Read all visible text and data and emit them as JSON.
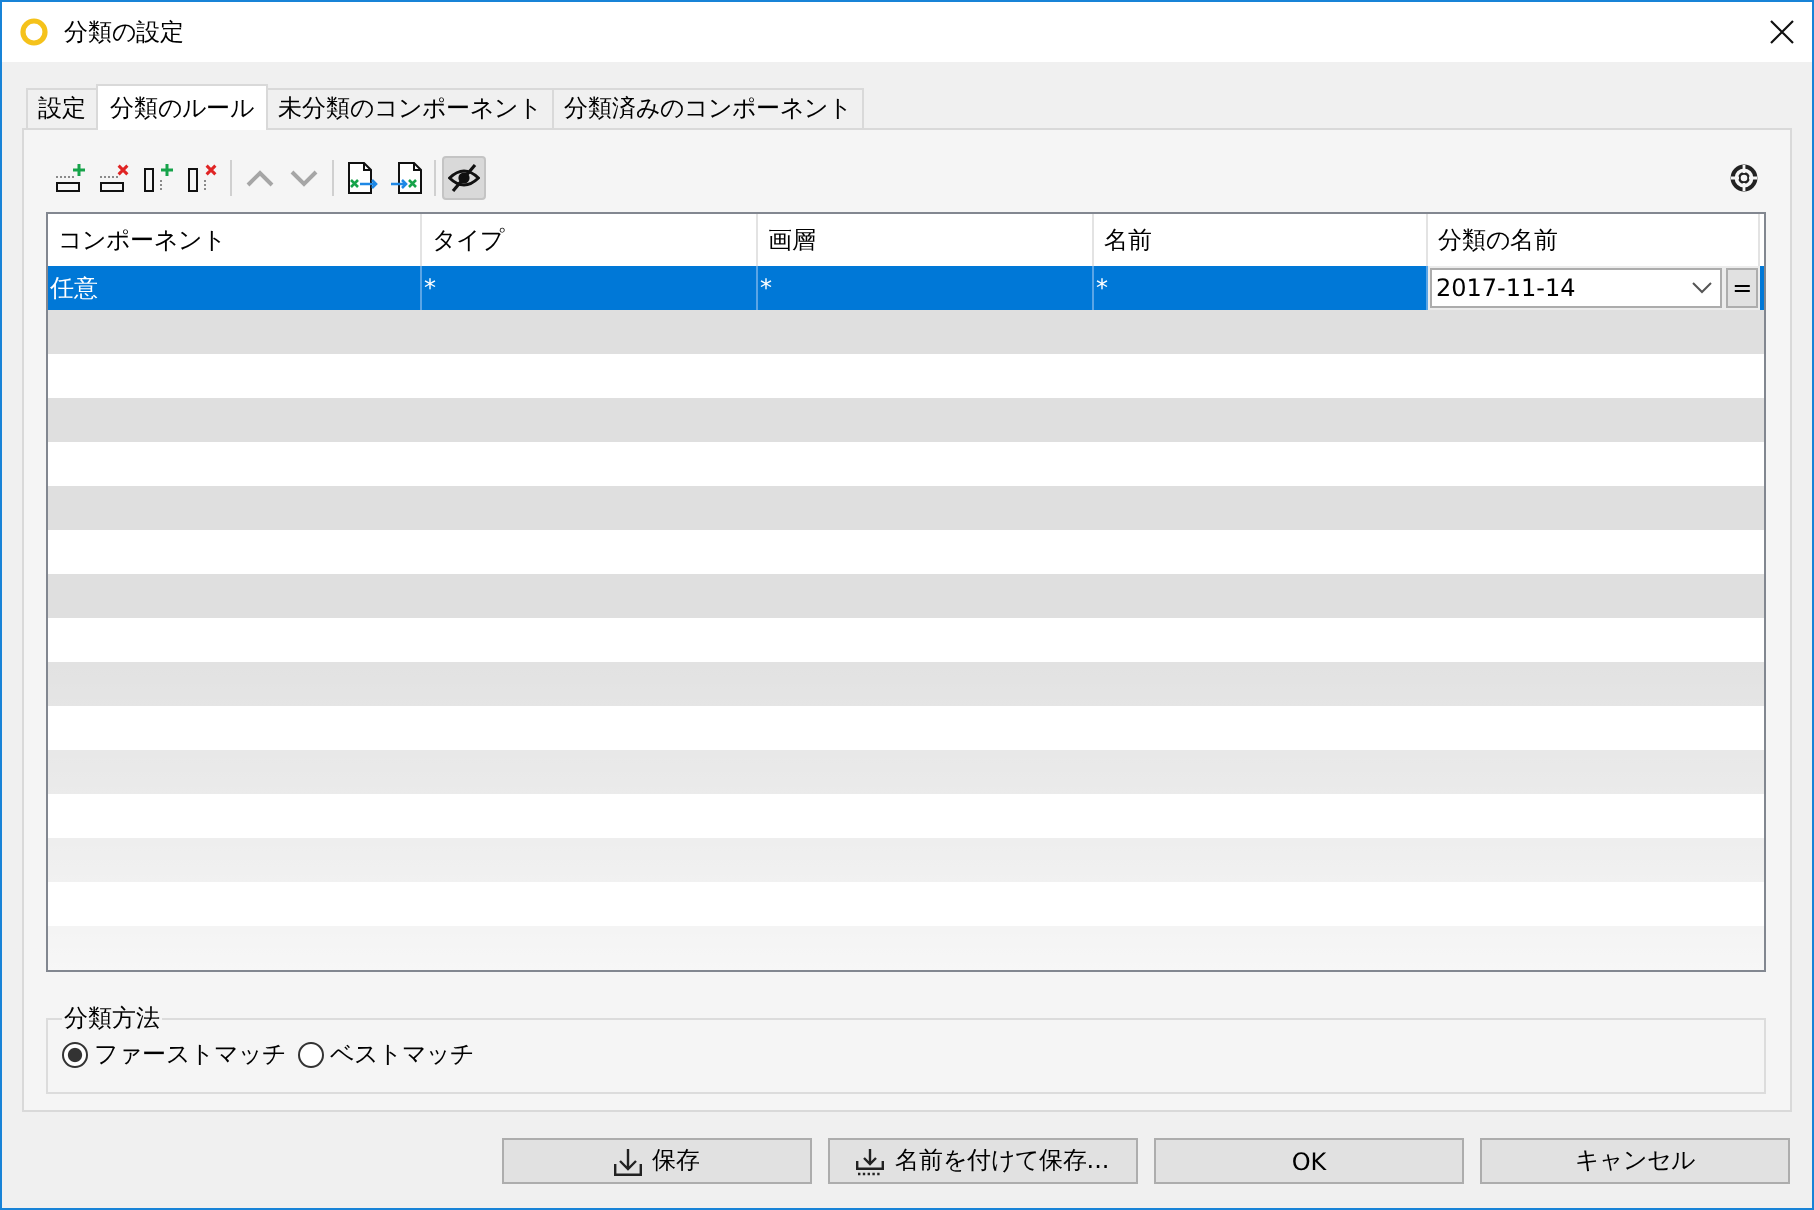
{
  "window": {
    "title": "分類の設定"
  },
  "tabs": [
    {
      "label": "設定",
      "selected": false
    },
    {
      "label": "分類のルール",
      "selected": true
    },
    {
      "label": "未分類のコンポーネント",
      "selected": false
    },
    {
      "label": "分類済みのコンポーネント",
      "selected": false
    }
  ],
  "toolbar": {
    "groups": [
      [
        {
          "kind": "add_row",
          "disabled": false,
          "pressed": false
        },
        {
          "kind": "remove_row",
          "disabled": false,
          "pressed": false
        },
        {
          "kind": "add_column",
          "disabled": false,
          "pressed": false
        },
        {
          "kind": "remove_column",
          "disabled": false,
          "pressed": false
        }
      ],
      [
        {
          "kind": "move_up",
          "disabled": true,
          "pressed": false
        },
        {
          "kind": "move_down",
          "disabled": true,
          "pressed": false
        }
      ],
      [
        {
          "kind": "export",
          "disabled": false,
          "pressed": false
        },
        {
          "kind": "import",
          "disabled": false,
          "pressed": false
        }
      ],
      [
        {
          "kind": "hide",
          "disabled": false,
          "pressed": true
        }
      ]
    ]
  },
  "table": {
    "columns": [
      "コンポーネント",
      "タイプ",
      "画層",
      "名前",
      "分類の名前"
    ],
    "rows": [
      {
        "selected": true,
        "cells": [
          "任意",
          "*",
          "*",
          "*"
        ],
        "category": {
          "value": "2017-11-14",
          "button": "="
        }
      }
    ]
  },
  "classification_method": {
    "title": "分類方法",
    "options": [
      {
        "label": "ファーストマッチ",
        "selected": true
      },
      {
        "label": "ベストマッチ",
        "selected": false
      }
    ]
  },
  "buttons": [
    {
      "kind": "save",
      "label": "保存"
    },
    {
      "kind": "save_as",
      "label": "名前を付けて保存..."
    },
    {
      "kind": "ok",
      "label": "OK"
    },
    {
      "kind": "cancel",
      "label": "キャンセル"
    }
  ]
}
